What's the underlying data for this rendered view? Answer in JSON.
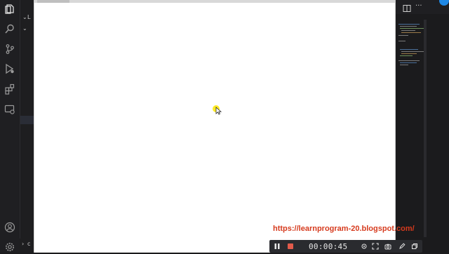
{
  "activity_bar": {
    "icons": [
      "explorer-icon",
      "search-icon",
      "source-control-icon",
      "run-debug-icon",
      "extensions-icon",
      "remote-explorer-icon",
      "account-icon",
      "settings-gear-icon"
    ]
  },
  "explorer": {
    "row1": "L",
    "row2": "c"
  },
  "watermark": {
    "text": "https://learnprogram-20.blogspot.com/"
  },
  "recorder": {
    "timer": "00:00:45",
    "icons": [
      "pause-icon",
      "stop-icon",
      "screenshot-region-icon",
      "fullscreen-icon",
      "camera-icon",
      "pen-icon",
      "window-icon"
    ]
  },
  "colors": {
    "accent": "#d63a1d",
    "stop": "#e25b4b",
    "cursor_halo": "#ffe600",
    "remote_badge": "#1e88e5"
  }
}
